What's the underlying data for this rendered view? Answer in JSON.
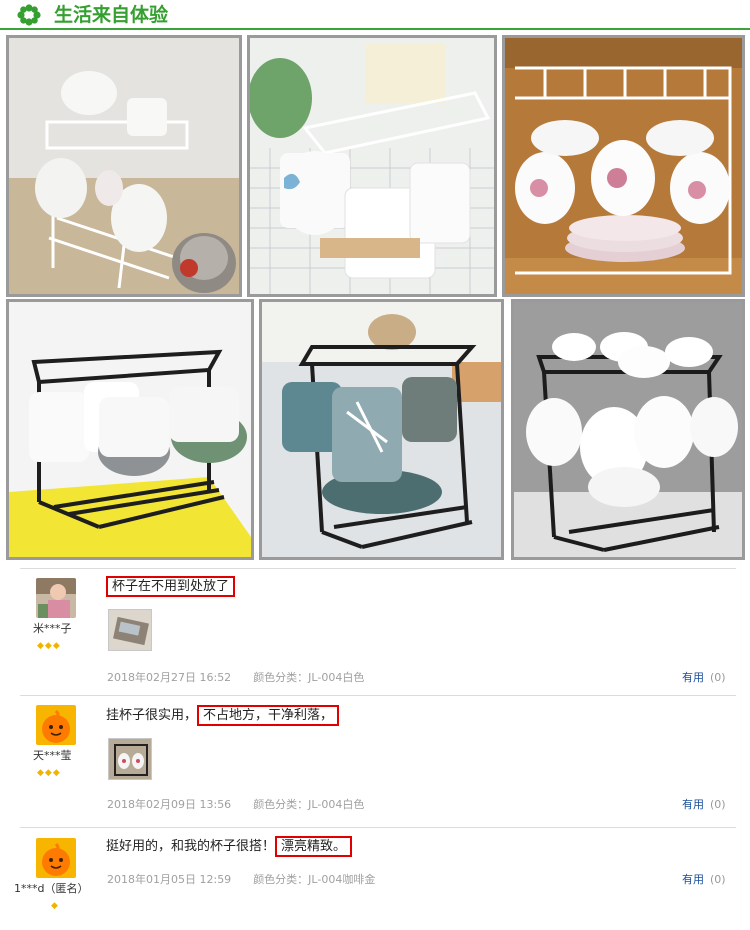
{
  "header": {
    "title": "生活来自体验",
    "icon": "green-flower-icon"
  },
  "photos": [
    {
      "id": "photo-1",
      "desc": "white-rack-white-mugs-kettle"
    },
    {
      "id": "photo-2",
      "desc": "white-rack-two-white-mugs"
    },
    {
      "id": "photo-3",
      "desc": "white-rack-floral-cups-saucers"
    },
    {
      "id": "photo-4",
      "desc": "black-rack-green-mugs-yellow-tray"
    },
    {
      "id": "photo-5",
      "desc": "black-rack-leaf-mugs"
    },
    {
      "id": "photo-6",
      "desc": "black-rack-white-teacups"
    }
  ],
  "reviews": [
    {
      "username": "米***子",
      "rank": "◆◆◆",
      "comment_pre": "",
      "comment_highlight": "杯子在不用到处放了",
      "date": "2018年02月27日 16:52",
      "spec": "颜色分类：JL-004白色",
      "useful_label": "有用",
      "useful_count": "(0)"
    },
    {
      "username": "天***莹",
      "rank": "◆◆◆",
      "comment_pre": "挂杯子很实用，",
      "comment_highlight": "不占地方，干净利落，",
      "date": "2018年02月09日 13:56",
      "spec": "颜色分类：JL-004白色",
      "useful_label": "有用",
      "useful_count": "(0)"
    },
    {
      "username": "1***d（匿名）",
      "rank": "◆",
      "comment_pre": "挺好用的，和我的杯子很搭！",
      "comment_highlight": "漂亮精致。",
      "date": "2018年01月05日 12:59",
      "spec": "颜色分类：JL-004咖啡金",
      "useful_label": "有用",
      "useful_count": "(0)"
    }
  ],
  "colors": {
    "brand_green": "#35a030",
    "highlight_red": "#e00000",
    "link_blue": "#1a4e9c"
  }
}
